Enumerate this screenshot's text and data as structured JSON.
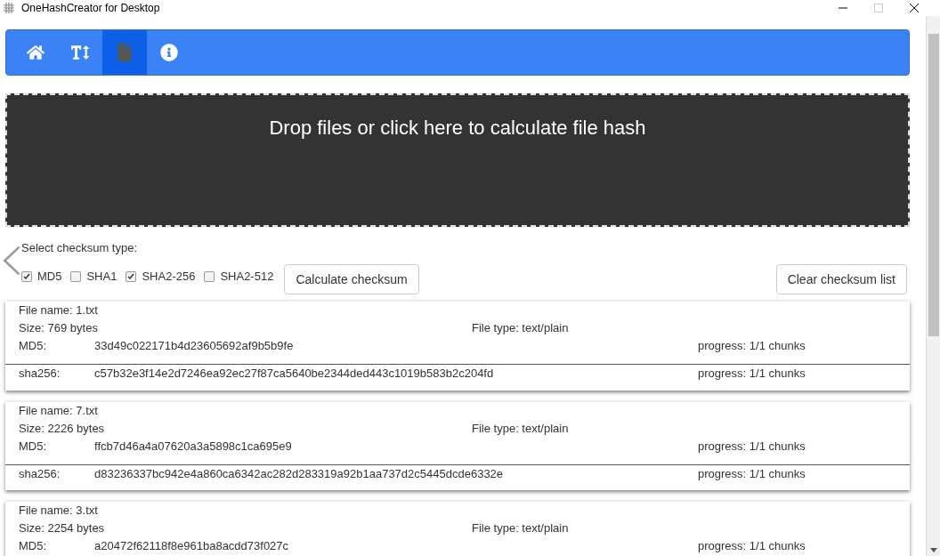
{
  "window": {
    "title": "OneHashCreator for Desktop"
  },
  "nav_tabs": [
    {
      "kind": "home",
      "selected": false
    },
    {
      "kind": "text",
      "selected": false
    },
    {
      "kind": "file",
      "selected": true
    },
    {
      "kind": "info",
      "selected": false
    }
  ],
  "drop_zone": {
    "text": "Drop files or click here to calculate file hash"
  },
  "checksum_select": {
    "label": "Select checksum type:",
    "options": [
      {
        "label": "MD5",
        "checked": true
      },
      {
        "label": "SHA1",
        "checked": false
      },
      {
        "label": "SHA2-256",
        "checked": true
      },
      {
        "label": "SHA2-512",
        "checked": false
      }
    ]
  },
  "buttons": {
    "calculate": "Calculate checksum",
    "clear": "Clear checksum list"
  },
  "files": [
    {
      "name": "File name: 1.txt",
      "size": "Size: 769 bytes",
      "type": "File type: text/plain",
      "hashes": [
        {
          "label": "MD5:",
          "value": "33d49c022171b4d23605692af9b5b9fe",
          "progress": "progress: 1/1 chunks"
        },
        {
          "label": "sha256:",
          "value": "c57b32e3f14e2d7246ea92ec27f87ca5640be2344ded443c1019b583b2c204fd",
          "progress": "progress: 1/1 chunks"
        }
      ]
    },
    {
      "name": "File name: 7.txt",
      "size": "Size: 2226 bytes",
      "type": "File type: text/plain",
      "hashes": [
        {
          "label": "MD5:",
          "value": "ffcb7d46a4a07620a3a5898c1ca695e9",
          "progress": "progress: 1/1 chunks"
        },
        {
          "label": "sha256:",
          "value": "d83236337bc942e4a860ca6342ac282d283319a92b1aa737d2c5445dcde6332e",
          "progress": "progress: 1/1 chunks"
        }
      ]
    },
    {
      "name": "File name: 3.txt",
      "size": "Size: 2254 bytes",
      "type": "File type: text/plain",
      "hashes": [
        {
          "label": "MD5:",
          "value": "a20472f62118f8e961ba8acdd73f027c",
          "progress": "progress: 1/1 chunks"
        }
      ]
    }
  ]
}
